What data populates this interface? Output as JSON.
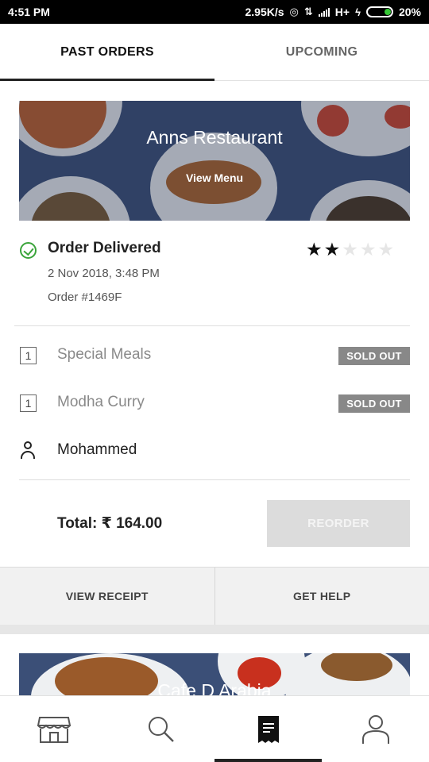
{
  "status_bar": {
    "time": "4:51 PM",
    "net_speed": "2.95K/s",
    "network": "H+",
    "battery": "20%"
  },
  "tabs": [
    {
      "label": "PAST ORDERS",
      "active": true
    },
    {
      "label": "UPCOMING",
      "active": false
    }
  ],
  "order": {
    "restaurant": "Anns Restaurant",
    "view_menu": "View Menu",
    "status": "Order Delivered",
    "date": "2 Nov 2018, 3:48 PM",
    "order_number": "Order #1469F",
    "rating": 2,
    "rating_max": 5,
    "items": [
      {
        "qty": "1",
        "name": "Special Meals",
        "badge": "SOLD OUT"
      },
      {
        "qty": "1",
        "name": "Modha Curry",
        "badge": "SOLD OUT"
      }
    ],
    "customer": "Mohammed",
    "total": "Total: ₹ 164.00",
    "reorder_label": "REORDER",
    "view_receipt_label": "VIEW RECEIPT",
    "get_help_label": "GET HELP"
  },
  "next_order": {
    "restaurant": "Cafe D Arabia"
  },
  "bottom_nav": [
    {
      "icon": "store-icon",
      "active": false
    },
    {
      "icon": "search-icon",
      "active": false
    },
    {
      "icon": "receipt-icon",
      "active": true
    },
    {
      "icon": "profile-icon",
      "active": false
    }
  ],
  "colors": {
    "success": "#3aa43a",
    "badge_bg": "#888888",
    "reorder_bg": "#dcdcdc"
  }
}
